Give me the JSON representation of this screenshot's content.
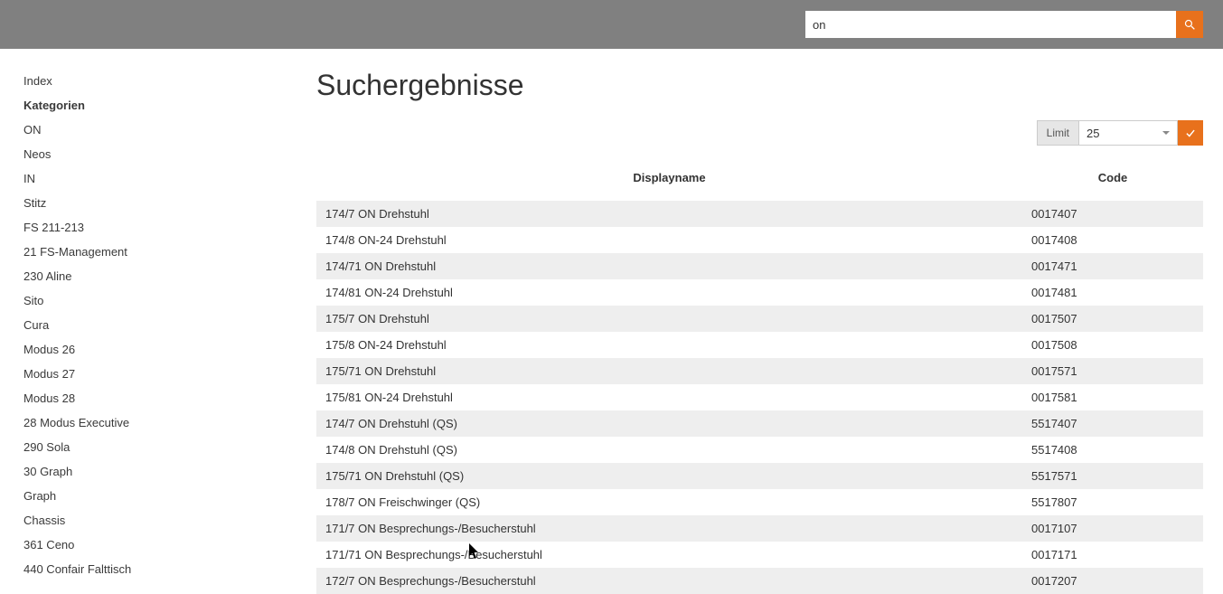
{
  "search": {
    "value": "on"
  },
  "sidebar": [
    {
      "label": "Index",
      "bold": false
    },
    {
      "label": "Kategorien",
      "bold": true
    },
    {
      "label": "ON",
      "bold": false
    },
    {
      "label": "Neos",
      "bold": false
    },
    {
      "label": "IN",
      "bold": false
    },
    {
      "label": "Stitz",
      "bold": false
    },
    {
      "label": "FS 211-213",
      "bold": false
    },
    {
      "label": "21 FS-Management",
      "bold": false
    },
    {
      "label": "230 Aline",
      "bold": false
    },
    {
      "label": "Sito",
      "bold": false
    },
    {
      "label": "Cura",
      "bold": false
    },
    {
      "label": "Modus 26",
      "bold": false
    },
    {
      "label": "Modus 27",
      "bold": false
    },
    {
      "label": "Modus 28",
      "bold": false
    },
    {
      "label": "28 Modus Executive",
      "bold": false
    },
    {
      "label": "290 Sola",
      "bold": false
    },
    {
      "label": "30 Graph",
      "bold": false
    },
    {
      "label": "Graph",
      "bold": false
    },
    {
      "label": "Chassis",
      "bold": false
    },
    {
      "label": "361 Ceno",
      "bold": false
    },
    {
      "label": "440 Confair Falttisch",
      "bold": false
    }
  ],
  "page_title": "Suchergebnisse",
  "limit": {
    "label": "Limit",
    "value": "25"
  },
  "table": {
    "headers": {
      "display": "Displayname",
      "code": "Code"
    },
    "rows": [
      {
        "display": "174/7 ON Drehstuhl",
        "code": "0017407"
      },
      {
        "display": "174/8 ON-24 Drehstuhl",
        "code": "0017408"
      },
      {
        "display": "174/71 ON Drehstuhl",
        "code": "0017471"
      },
      {
        "display": "174/81 ON-24 Drehstuhl",
        "code": "0017481"
      },
      {
        "display": "175/7 ON Drehstuhl",
        "code": "0017507"
      },
      {
        "display": "175/8 ON-24 Drehstuhl",
        "code": "0017508"
      },
      {
        "display": "175/71 ON Drehstuhl",
        "code": "0017571"
      },
      {
        "display": "175/81 ON-24 Drehstuhl",
        "code": "0017581"
      },
      {
        "display": "174/7 ON Drehstuhl (QS)",
        "code": "5517407"
      },
      {
        "display": "174/8 ON Drehstuhl (QS)",
        "code": "5517408"
      },
      {
        "display": "175/71 ON Drehstuhl (QS)",
        "code": "5517571"
      },
      {
        "display": "178/7 ON Freischwinger (QS)",
        "code": "5517807"
      },
      {
        "display": "171/7 ON Besprechungs-/Besucherstuhl",
        "code": "0017107"
      },
      {
        "display": "171/71 ON Besprechungs-/Besucherstuhl",
        "code": "0017171"
      },
      {
        "display": "172/7 ON Besprechungs-/Besucherstuhl",
        "code": "0017207"
      }
    ]
  }
}
